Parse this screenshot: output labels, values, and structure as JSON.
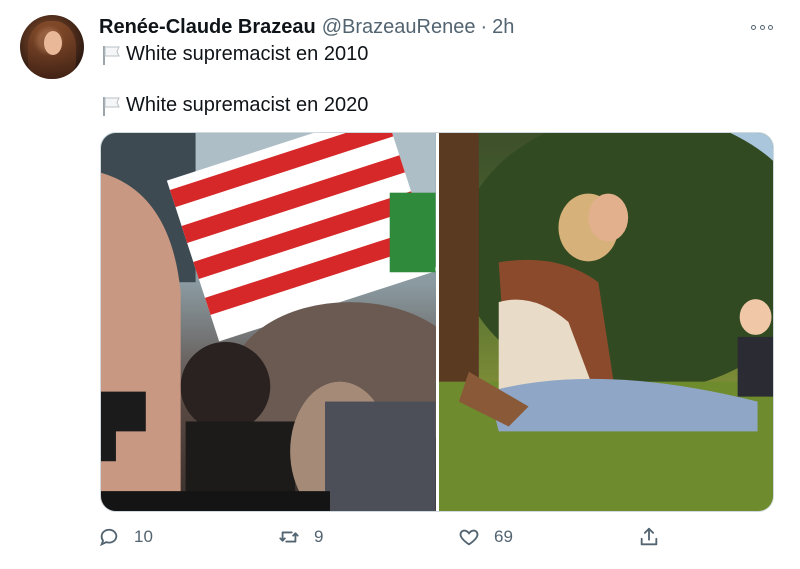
{
  "tweet": {
    "author_name": "Renée-Claude Brazeau",
    "handle": "@BrazeauRenee",
    "separator": "·",
    "timestamp": "2h",
    "lines": [
      {
        "emoji": "white-flag",
        "text": "White supremacist en 2010"
      },
      {
        "emoji": "white-flag",
        "text": "White supremacist en 2020"
      }
    ],
    "media": [
      {
        "description_icon": "photo-rally-flag"
      },
      {
        "description_icon": "photo-family-park"
      }
    ],
    "actions": {
      "replies": "10",
      "retweets": "9",
      "likes": "69"
    }
  },
  "colors": {
    "text_primary": "#0f1419",
    "text_secondary": "#536471",
    "border": "#cfd9de"
  },
  "icons": [
    "more-icon",
    "reply-icon",
    "retweet-icon",
    "like-icon",
    "share-icon",
    "white-flag-icon"
  ]
}
